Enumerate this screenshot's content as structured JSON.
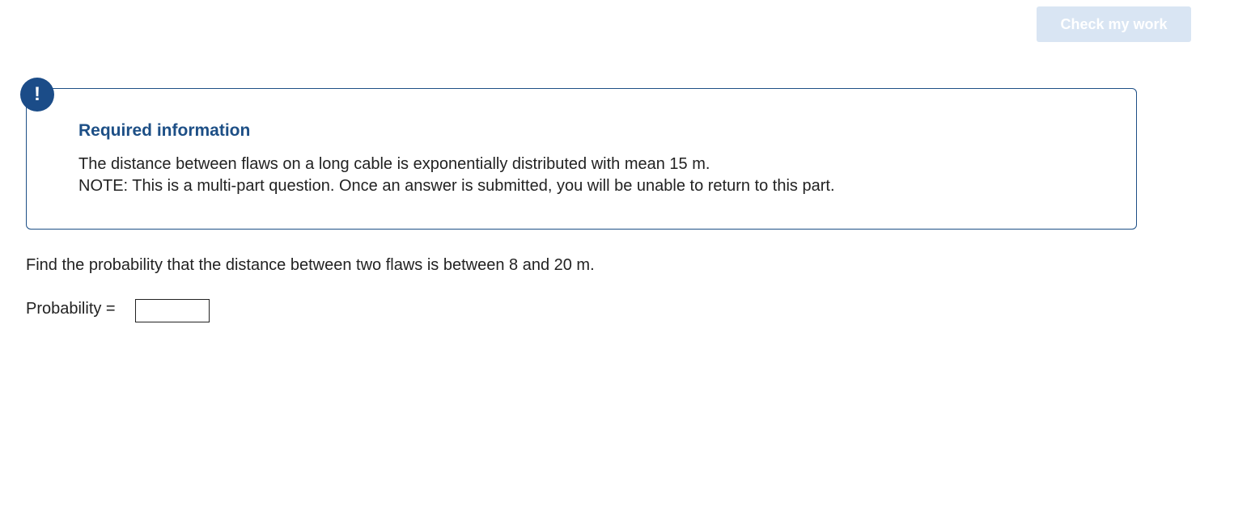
{
  "toolbar": {
    "check_label": "Check my work"
  },
  "info": {
    "icon_glyph": "!",
    "title": "Required information",
    "line1": "The distance between flaws on a long cable is exponentially distributed with mean 15 m.",
    "line2": "NOTE: This is a multi-part question. Once an answer is submitted, you will be unable to return to this part."
  },
  "question": {
    "text": "Find the probability that the distance between two flaws is between 8 and 20 m.",
    "answer_label": "Probability =",
    "answer_value": ""
  },
  "colors": {
    "accent": "#1d4f86",
    "button_disabled": "#d9e5f3"
  },
  "icons": {
    "alert": "alert-icon"
  }
}
